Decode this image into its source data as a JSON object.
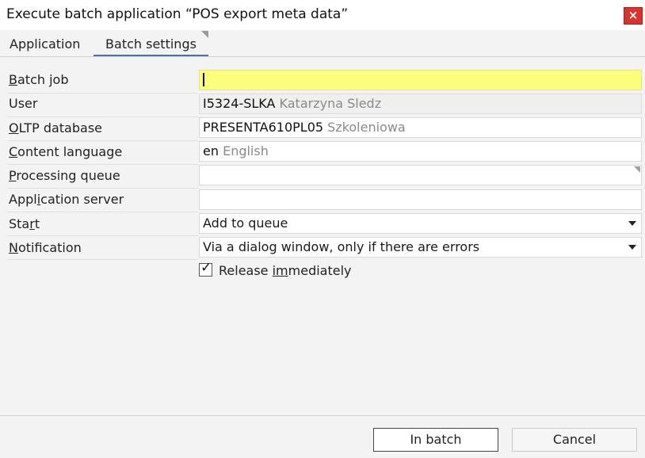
{
  "window": {
    "title": "Execute batch application “POS export meta data”",
    "close_icon": "×"
  },
  "tabs": [
    {
      "label": "Application"
    },
    {
      "label": "Batch settings",
      "active": true
    }
  ],
  "form": {
    "batch_job": {
      "label_u": "B",
      "label_rest": "atch job",
      "value": ""
    },
    "user": {
      "label": "User",
      "code": "I5324-SLKA",
      "name": "Katarzyna Sledz"
    },
    "oltp": {
      "label_u": "O",
      "label_rest": "LTP database",
      "code": "PRESENTA610PL05",
      "name": "Szkoleniowa"
    },
    "content_language": {
      "label_u": "C",
      "label_rest": "ontent language",
      "code": "en",
      "name": "English"
    },
    "processing_queue": {
      "label_u": "P",
      "label_rest": "rocessing queue",
      "value": ""
    },
    "application_server": {
      "label_pre": "Appl",
      "label_u": "i",
      "label_rest": "cation server",
      "value": ""
    },
    "start": {
      "label_pre": "Sta",
      "label_u": "r",
      "label_rest": "t",
      "value": "Add to queue"
    },
    "notification": {
      "label_u": "N",
      "label_rest": "otification",
      "value": "Via a dialog window, only if there are errors"
    },
    "release": {
      "label_pre": "Release ",
      "label_u": "im",
      "label_rest": "mediately",
      "checked": true
    }
  },
  "buttons": {
    "batch": "In batch",
    "cancel": "Cancel"
  },
  "colors": {
    "active_field": "#fdfd7d",
    "close_button": "#d9332f",
    "tab_underline": "#4a6fb5"
  }
}
